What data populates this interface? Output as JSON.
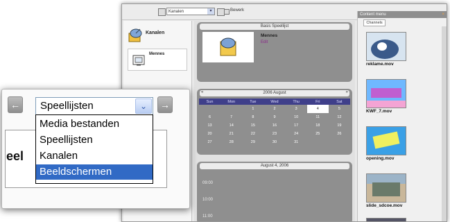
{
  "window": {
    "toolbar": {
      "select_value": "Kanalen",
      "select_arrow": "▾",
      "button_label": "Bewerk"
    },
    "sidebar": {
      "items": [
        {
          "label": "Kanalen",
          "icon": "satellite-dish-icon"
        },
        {
          "label": "Mennes",
          "icon": "tv-icon"
        }
      ]
    },
    "playlist_panel": {
      "title": "Basis Speellijst",
      "item_title": "Mennes",
      "item_sub": "Edit"
    },
    "calendar": {
      "title": "2006 August",
      "prev": "«",
      "next": "»",
      "day_headers": [
        "Sun",
        "Mon",
        "Tue",
        "Wed",
        "Thu",
        "Fri",
        "Sat"
      ],
      "weeks": [
        [
          "",
          "",
          "1",
          "2",
          "3",
          "4",
          "5"
        ],
        [
          "6",
          "7",
          "8",
          "9",
          "10",
          "11",
          "12"
        ],
        [
          "13",
          "14",
          "15",
          "16",
          "17",
          "18",
          "19"
        ],
        [
          "20",
          "21",
          "22",
          "23",
          "24",
          "25",
          "26"
        ],
        [
          "27",
          "28",
          "29",
          "30",
          "31",
          "",
          ""
        ]
      ],
      "selected_day": "4"
    },
    "day_panel": {
      "title": "August 4, 2006",
      "times": [
        "09:00",
        "10:00",
        "11:00"
      ]
    },
    "content_panel": {
      "title": "Content menu",
      "close": "×",
      "tab": "Channels",
      "clips": [
        {
          "label": "reklame.mov",
          "colors": [
            "#3a5a8a",
            "#d7e4f0"
          ]
        },
        {
          "label": "KWF_7.mov",
          "colors": [
            "#6fb8ff",
            "#c05fd0"
          ]
        },
        {
          "label": "opening.mov",
          "colors": [
            "#3aa0e6",
            "#f0f060"
          ]
        },
        {
          "label": "slide_sdcoe.mov",
          "colors": [
            "#6a7a6a",
            "#c9b79a"
          ]
        }
      ]
    }
  },
  "callout": {
    "back_icon": "←",
    "forward_icon": "→",
    "combo_value": "Speellijsten",
    "combo_arrow": "⌄",
    "options": [
      {
        "label": "Media bestanden",
        "selected": false
      },
      {
        "label": "Speellijsten",
        "selected": false
      },
      {
        "label": "Kanalen",
        "selected": false
      },
      {
        "label": "Beeldschermen",
        "selected": true
      }
    ],
    "background_text": "eel"
  }
}
